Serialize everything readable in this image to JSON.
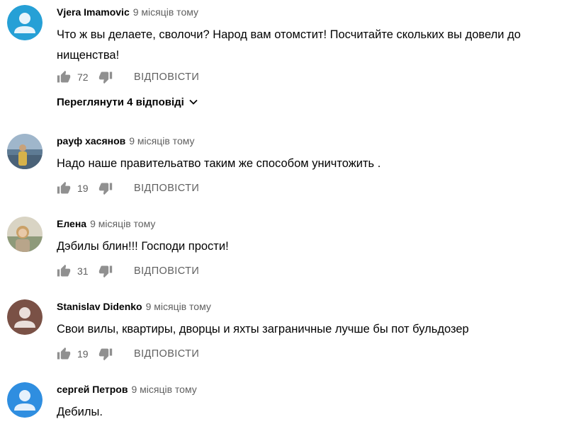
{
  "comments": [
    {
      "author": "Vjera Imamovic",
      "time": "9 місяців тому",
      "text_lines": [
        "Что ж вы делаете, сволочи? Народ вам отомстит! Посчитайте скольких вы довели до",
        "нищенства!"
      ],
      "likes": "72",
      "reply_label": "ВІДПОВІСТИ",
      "view_replies_label": "Переглянути 4 відповіді",
      "avatar_color": "#26a0d6"
    },
    {
      "author": "рауф хасянов",
      "time": "9 місяців тому",
      "text_lines": [
        "Надо наше правительатво таким же способом  уничтожить ."
      ],
      "likes": "19",
      "reply_label": "ВІДПОВІСТИ",
      "avatar_color": "#8aa6c0"
    },
    {
      "author": "Елена",
      "time": "9 місяців тому",
      "text_lines": [
        "Дэбилы блин!!! Господи прости!"
      ],
      "likes": "31",
      "reply_label": "ВІДПОВІСТИ",
      "avatar_color": "#c9b79a"
    },
    {
      "author": "Stanislav Didenko",
      "time": "9 місяців тому",
      "text_lines": [
        "Свои вилы, квартиры, дворцы и яхты заграничные лучше бы пот бульдозер"
      ],
      "likes": "19",
      "reply_label": "ВІДПОВІСТИ",
      "avatar_color": "#7a5146"
    },
    {
      "author": "сергей Петров",
      "time": "9 місяців тому",
      "text_lines": [
        "Дебилы."
      ],
      "avatar_color": "#2f8ee0"
    }
  ],
  "icons": {
    "like": "thumb-up-icon",
    "dislike": "thumb-down-icon",
    "expand": "chevron-down-icon",
    "default_avatar": "person-icon"
  },
  "colors": {
    "secondary_text": "#606060",
    "primary_text": "#030303"
  }
}
